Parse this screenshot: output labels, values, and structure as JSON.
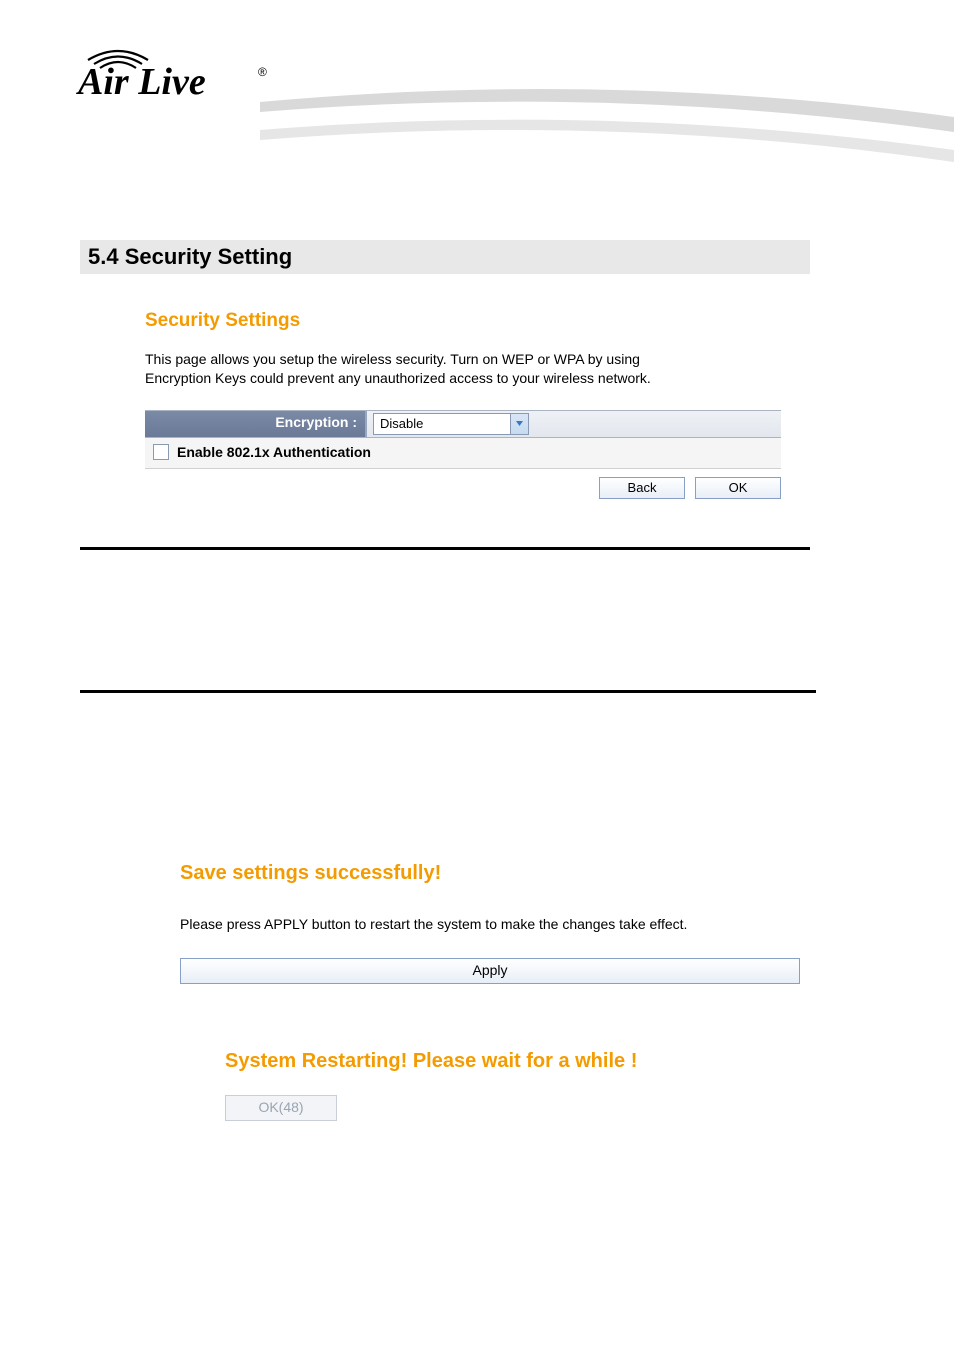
{
  "logo_text": "Air Live",
  "section_heading": "5.4 Security  Setting",
  "security": {
    "title": "Security Settings",
    "description": "This page allows you setup the wireless security. Turn on WEP or WPA by using Encryption Keys could prevent any unauthorized access to your wireless network.",
    "encryption_label": "Encryption :",
    "encryption_value": "Disable",
    "enable_8021x_label": "Enable 802.1x Authentication",
    "back_label": "Back",
    "ok_label": "OK"
  },
  "save": {
    "title": "Save settings successfully!",
    "description": "Please press APPLY button to restart the system to make the changes take effect.",
    "apply_label": "Apply"
  },
  "restart": {
    "title": "System Restarting! Please wait for a while !",
    "ok_label": "OK(48)"
  }
}
